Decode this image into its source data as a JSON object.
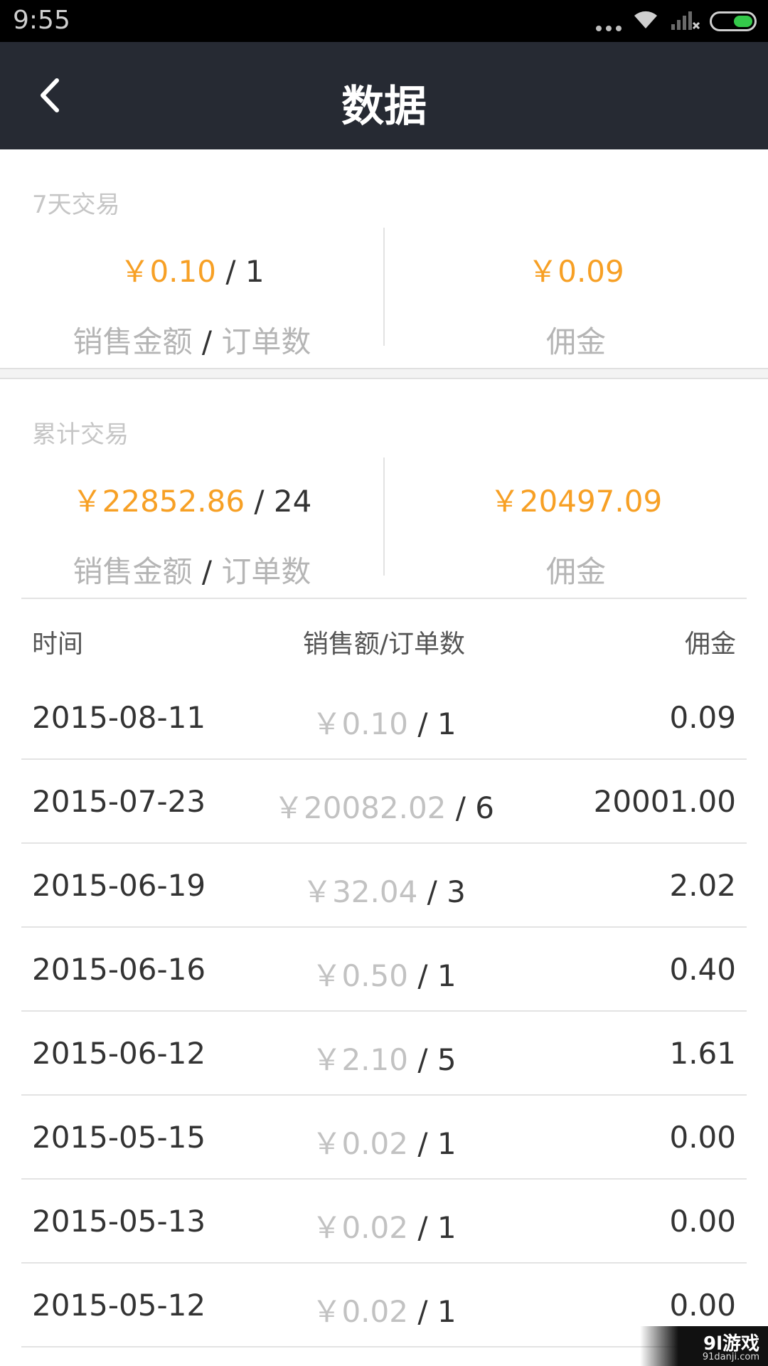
{
  "status_bar": {
    "time": "9:55",
    "icons": [
      "more-dots-icon",
      "wifi-icon",
      "signal-icon",
      "battery-icon"
    ]
  },
  "header": {
    "title": "数据",
    "back_icon": "back-arrow-icon"
  },
  "colors": {
    "accent": "#f7a025",
    "header_bg": "#262a33",
    "muted": "#c2c2c2"
  },
  "seven_day": {
    "title": "7天交易",
    "sales_amount": "￥0.10",
    "sep": " / ",
    "order_count": "1",
    "commission": "￥0.09",
    "label_sales": "销售金额",
    "label_sep": " / ",
    "label_orders": "订单数",
    "label_commission": "佣金"
  },
  "cumulative": {
    "title": "累计交易",
    "sales_amount": "￥22852.86",
    "sep": " / ",
    "order_count": "24",
    "commission": "￥20497.09",
    "label_sales": "销售金额",
    "label_sep": " / ",
    "label_orders": "订单数",
    "label_commission": "佣金"
  },
  "table": {
    "headers": {
      "time": "时间",
      "sales": "销售额/订单数",
      "commission": "佣金"
    },
    "rows": [
      {
        "date": "2015-08-11",
        "amount": "￥0.10",
        "orders": " / 1",
        "commission": "0.09"
      },
      {
        "date": "2015-07-23",
        "amount": "￥20082.02",
        "orders": " / 6",
        "commission": "20001.00"
      },
      {
        "date": "2015-06-19",
        "amount": "￥32.04",
        "orders": " / 3",
        "commission": "2.02"
      },
      {
        "date": "2015-06-16",
        "amount": "￥0.50",
        "orders": " / 1",
        "commission": "0.40"
      },
      {
        "date": "2015-06-12",
        "amount": "￥2.10",
        "orders": " / 5",
        "commission": "1.61"
      },
      {
        "date": "2015-05-15",
        "amount": "￥0.02",
        "orders": " / 1",
        "commission": "0.00"
      },
      {
        "date": "2015-05-13",
        "amount": "￥0.02",
        "orders": " / 1",
        "commission": "0.00"
      },
      {
        "date": "2015-05-12",
        "amount": "￥0.02",
        "orders": " / 1",
        "commission": "0.00"
      }
    ]
  },
  "watermark": {
    "main": "9l游戏",
    "sub": "91danji.com"
  }
}
